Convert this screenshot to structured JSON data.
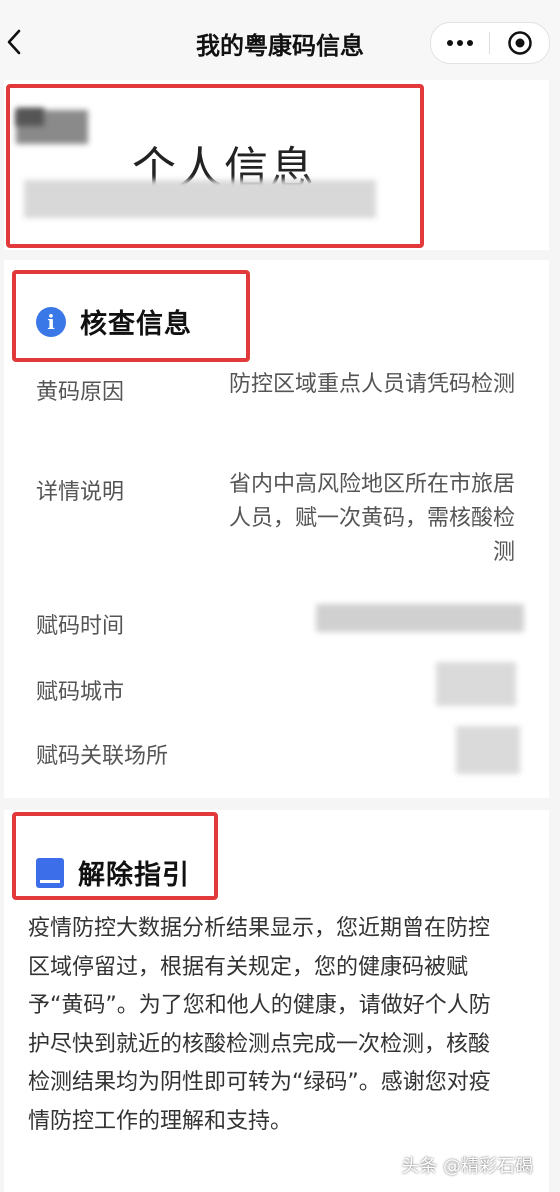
{
  "nav": {
    "title": "我的粤康码信息"
  },
  "personal": {
    "title": "个人信息"
  },
  "check": {
    "section_title": "核查信息",
    "rows": [
      {
        "label": "黄码原因",
        "value": "防控区域重点人员请凭码检测"
      },
      {
        "label": "详情说明",
        "value": "省内中高风险地区所在市旅居人员，赋一次黄码，需核酸检测"
      },
      {
        "label": "赋码时间",
        "value": ""
      },
      {
        "label": "赋码城市",
        "value": ""
      },
      {
        "label": "赋码关联场所",
        "value": ""
      }
    ]
  },
  "guide": {
    "section_title": "解除指引",
    "text": "疫情防控大数据分析结果显示，您近期曾在防控区域停留过，根据有关规定，您的健康码被赋予“黄码”。为了您和他人的健康，请做好个人防护尽快到就近的核酸检测点完成一次检测，核酸检测结果均为阴性即可转为“绿码”。感谢您对疫情防控工作的理解和支持。"
  },
  "watermark": "头条 @精彩石碣"
}
